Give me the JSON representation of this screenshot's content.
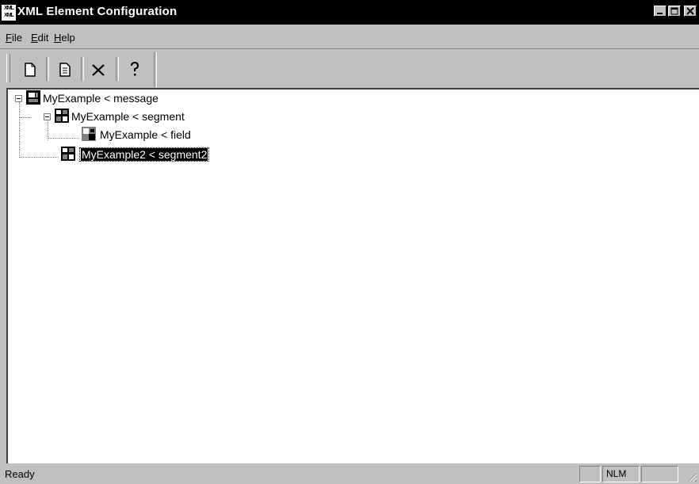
{
  "window": {
    "title": "XML Element Configuration",
    "icon_text": "XML"
  },
  "menu": [
    {
      "label": "File",
      "mnemonic": "F"
    },
    {
      "label": "Edit",
      "mnemonic": "E"
    },
    {
      "label": "Help",
      "mnemonic": "H"
    }
  ],
  "toolbar": {
    "buttons": [
      "new-icon",
      "properties-icon",
      "delete-icon",
      "help-icon"
    ]
  },
  "tree": {
    "nodes": [
      {
        "label": "MyExample < message",
        "icon": "message-icon",
        "expanded": true,
        "selected": false
      },
      {
        "label": "MyExample < segment",
        "icon": "segment-icon",
        "expanded": true,
        "selected": false
      },
      {
        "label": "MyExample < field",
        "icon": "field-icon",
        "selected": false
      },
      {
        "label": "MyExample2 < segment2",
        "icon": "segment-icon",
        "selected": true
      }
    ]
  },
  "statusbar": {
    "text": "Ready",
    "panels": [
      "",
      "NLM",
      ""
    ]
  }
}
